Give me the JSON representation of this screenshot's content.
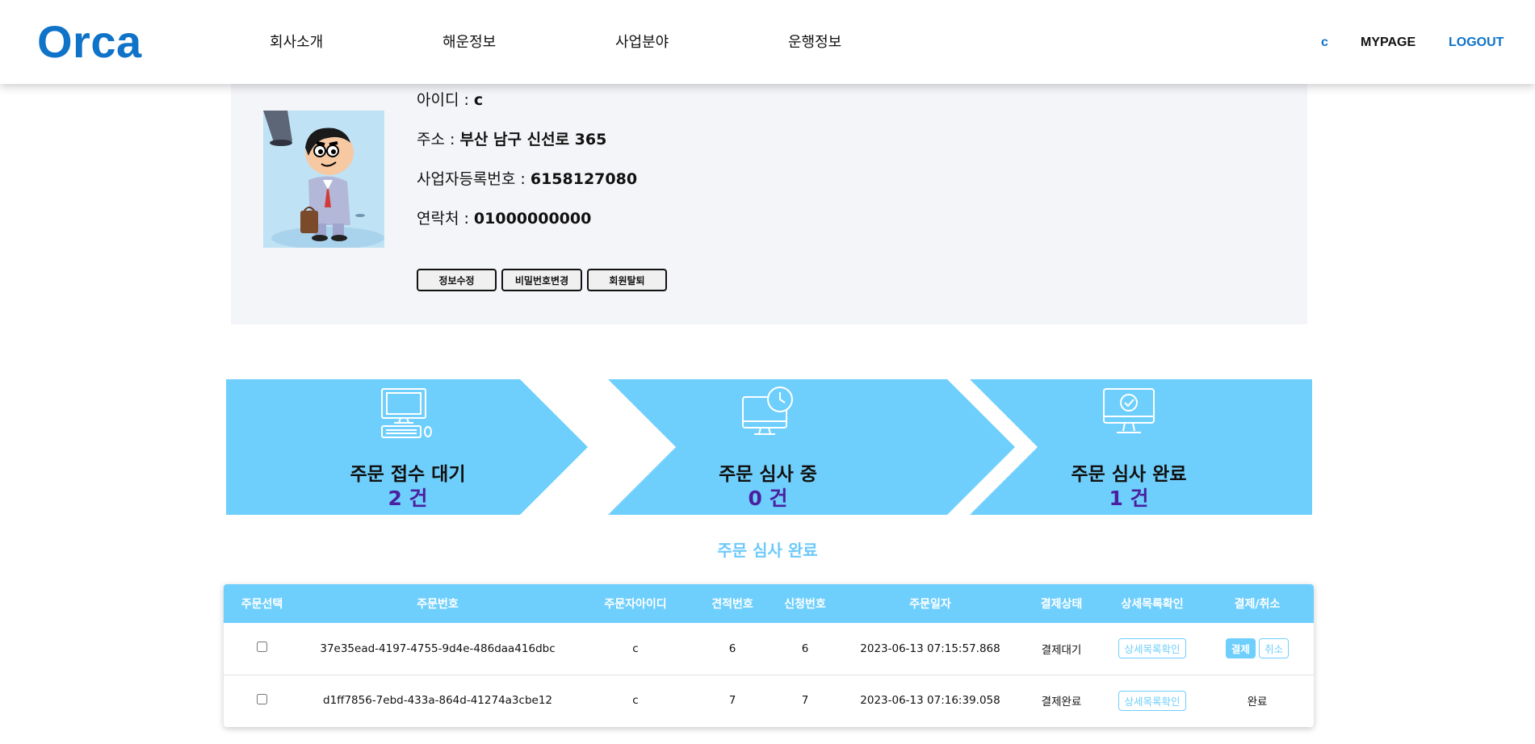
{
  "colors": {
    "brand": "#0f73c8",
    "accent": "#6fcffc",
    "count": "#4a1fa0",
    "profile_bg": "#f4f5f8"
  },
  "header": {
    "logo": "Orca",
    "nav": [
      "회사소개",
      "해운정보",
      "사업분야",
      "운행정보"
    ],
    "user": "c",
    "mypage": "MYPAGE",
    "logout": "LOGOUT"
  },
  "profile": {
    "avatar_icon": "cartoon-avatar-icon",
    "fields": [
      {
        "label": "아이디 : ",
        "value": "c"
      },
      {
        "label": "주소 : ",
        "value": "부산 남구 신선로 365"
      },
      {
        "label": "사업자등록번호 : ",
        "value": "6158127080"
      },
      {
        "label": "연락처 : ",
        "value": "01000000000"
      }
    ],
    "buttons": [
      "정보수정",
      "비밀번호변경",
      "회원탈퇴"
    ]
  },
  "steps": [
    {
      "icon": "computer-icon",
      "label": "주문 접수 대기",
      "count": "2 건"
    },
    {
      "icon": "monitor-clock-icon",
      "label": "주문 심사 중",
      "count": "0 건"
    },
    {
      "icon": "monitor-check-icon",
      "label": "주문 심사 완료",
      "count": "1 건"
    }
  ],
  "section_title": "주문 심사 완료",
  "table": {
    "headers": [
      "주문선택",
      "주문번호",
      "주문자아이디",
      "견적번호",
      "신청번호",
      "주문일자",
      "결제상태",
      "상세목록확인",
      "결제/취소"
    ],
    "rows": [
      {
        "order_no": "37e35ead-4197-4755-9d4e-486daa416dbc",
        "user_id": "c",
        "quote_no": "6",
        "apply_no": "6",
        "date": "2023-06-13 07:15:57.868",
        "status": "결제대기",
        "detail": "상세목록확인",
        "pay": "결제",
        "cancel": "취소"
      },
      {
        "order_no": "d1ff7856-7ebd-433a-864d-41274a3cbe12",
        "user_id": "c",
        "quote_no": "7",
        "apply_no": "7",
        "date": "2023-06-13 07:16:39.058",
        "status": "결제완료",
        "detail": "상세목록확인",
        "done": "완료"
      }
    ]
  }
}
